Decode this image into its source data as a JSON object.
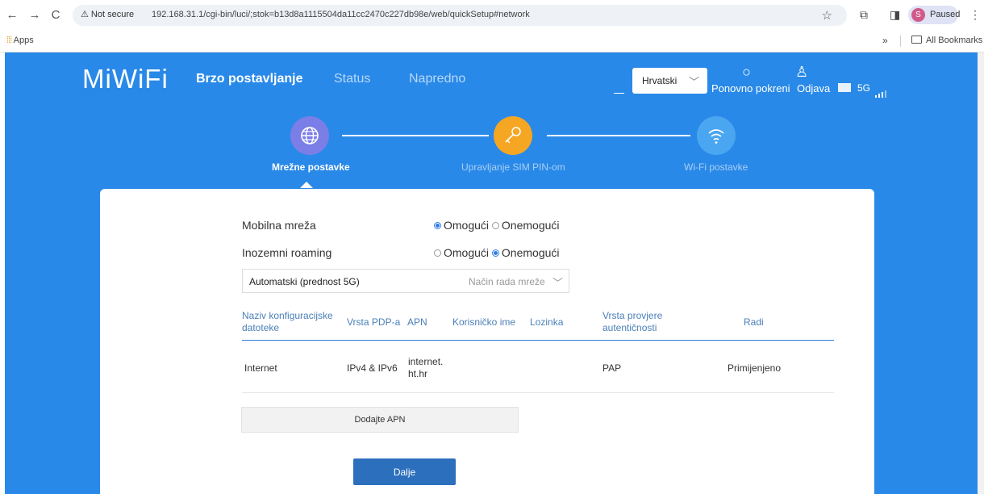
{
  "browser": {
    "back": "←",
    "forward": "→",
    "reload": "C",
    "security_label": "Not secure",
    "url": "192.168.31.1/cgi-bin/luci/;stok=b13d8a1115504da11cc2470c227db98e/web/quickSetup#network",
    "profile_initial": "S",
    "profile_status": "Paused",
    "apps_label": "Apps",
    "all_bookmarks_label": "All Bookmarks",
    "overflow": "»",
    "more": "⋮"
  },
  "header": {
    "logo": "MiWiFi",
    "nav": [
      "Brzo postavljanje",
      "Status",
      "Napredno"
    ],
    "language": "Hrvatski",
    "restart_label": "Ponovno pokreni",
    "logout_label": "Odjava",
    "network_label": "5G"
  },
  "steps": [
    {
      "label": "Mrežne postavke",
      "icon": "globe-icon",
      "color": "#7b7ee6",
      "active": true
    },
    {
      "label": "Upravljanje SIM PIN-om",
      "icon": "key-icon",
      "color": "#f5a623",
      "active": false
    },
    {
      "label": "Wi-Fi postavke",
      "icon": "wifi-icon",
      "color": "#4aa6f0",
      "active": false
    }
  ],
  "form": {
    "mobile_network": {
      "label": "Mobilna mreža",
      "options": [
        "Omogući",
        "Onemogući"
      ],
      "selected": "Omogući"
    },
    "roaming": {
      "label": "Inozemni roaming",
      "options": [
        "Omogući",
        "Onemogući"
      ],
      "selected": "Onemogući"
    },
    "network_mode": {
      "value": "Automatski (prednost 5G)",
      "placeholder": "Način rada mreže"
    }
  },
  "apn_table": {
    "headers": [
      "Naziv konfiguracijske datoteke",
      "Vrsta PDP-a",
      "APN",
      "Korisničko ime",
      "Lozinka",
      "Vrsta provjere autentičnosti",
      "Radi"
    ],
    "rows": [
      {
        "name": "Internet",
        "pdp": "IPv4 & IPv6",
        "apn": "internet. ht.hr",
        "user": "",
        "password": "",
        "auth": "PAP",
        "action": "Primijenjeno"
      }
    ]
  },
  "buttons": {
    "add_apn": "Dodajte APN",
    "next": "Dalje"
  },
  "colors": {
    "page_bg": "#2989e8",
    "primary_button": "#2c6fbd",
    "table_header": "#4a7fb8"
  }
}
